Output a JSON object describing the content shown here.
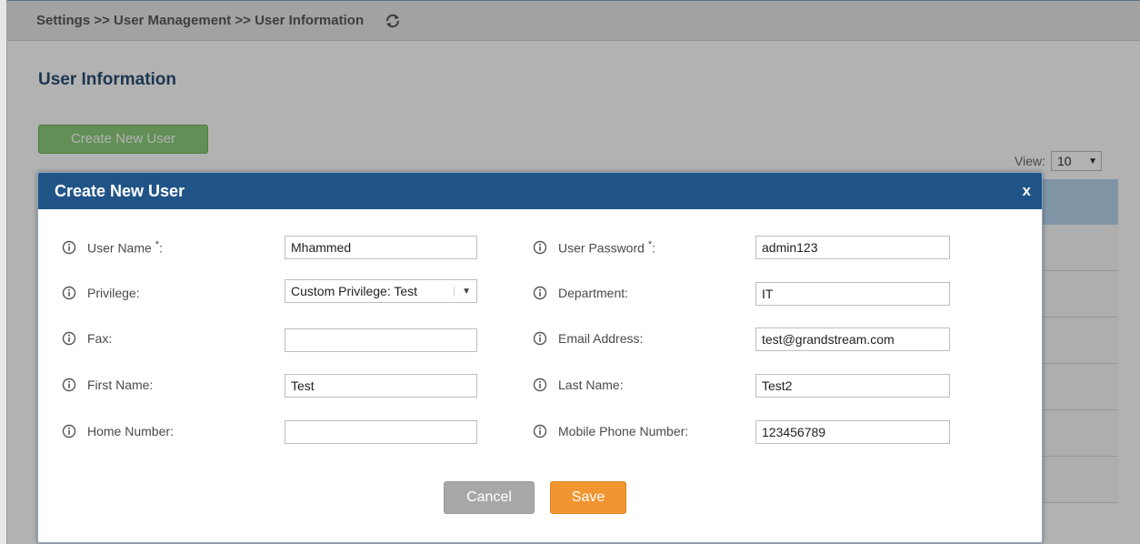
{
  "breadcrumb": {
    "text": "Settings >> User Management >> User Information"
  },
  "page": {
    "title": "User Information",
    "create_button": "Create New User",
    "view_label": "View:",
    "view_value": "10"
  },
  "modal": {
    "title": "Create New User",
    "close": "x",
    "fields": {
      "user_name": {
        "label": "User Name",
        "required": "*",
        "colon": ":",
        "value": "Mhammed"
      },
      "user_password": {
        "label": "User Password",
        "required": "*",
        "colon": ":",
        "value": "admin123"
      },
      "privilege": {
        "label": "Privilege:",
        "value": "Custom Privilege: Test"
      },
      "department": {
        "label": "Department:",
        "value": "IT"
      },
      "fax": {
        "label": "Fax:",
        "value": ""
      },
      "email": {
        "label": "Email Address:",
        "value": "test@grandstream.com"
      },
      "first_name": {
        "label": "First Name:",
        "value": "Test"
      },
      "last_name": {
        "label": "Last Name:",
        "value": "Test2"
      },
      "home_number": {
        "label": "Home Number:",
        "value": ""
      },
      "mobile": {
        "label": "Mobile Phone Number:",
        "value": "123456789"
      }
    },
    "cancel_label": "Cancel",
    "save_label": "Save"
  },
  "colors": {
    "header_blue": "#205487",
    "title_blue": "#2c4f73",
    "save_orange": "#f0952f",
    "create_green": "#8ccd7a",
    "cancel_gray": "#a8a8a8"
  },
  "icons": {
    "refresh": "refresh-icon",
    "info": "info-icon",
    "dropdown": "chevron-down-icon"
  }
}
